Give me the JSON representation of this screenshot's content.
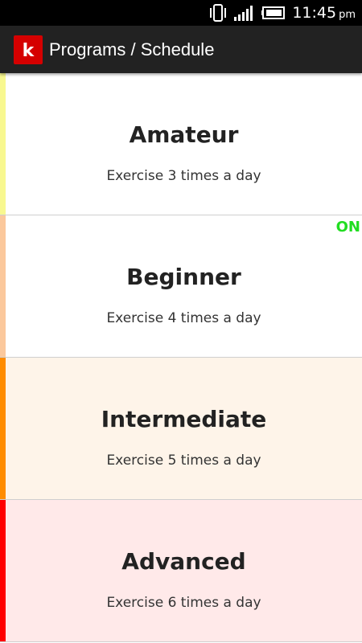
{
  "status_bar": {
    "time": "11:45",
    "ampm": "pm",
    "icons": [
      "vibrate-icon",
      "signal-icon",
      "battery-icon"
    ]
  },
  "action_bar": {
    "app_icon_letter": "k",
    "title": "Programs / Schedule"
  },
  "programs": [
    {
      "name": "Amateur",
      "description": "Exercise 3 times a day",
      "status": "",
      "stripe_color": "#f8f890",
      "background": "#ffffff"
    },
    {
      "name": "Beginner",
      "description": "Exercise 4 times a day",
      "status": "ON",
      "stripe_color": "#fbc89c",
      "background": "#ffffff"
    },
    {
      "name": "Intermediate",
      "description": "Exercise 5 times a day",
      "status": "",
      "stripe_color": "#ff8c00",
      "background": "#fef4e9"
    },
    {
      "name": "Advanced",
      "description": "Exercise 6 times a day",
      "status": "",
      "stripe_color": "#ff0000",
      "background": "#ffe9e9"
    }
  ],
  "colors": {
    "status_on": "#22dd22",
    "action_bar": "#222222",
    "app_icon": "#d50000"
  }
}
